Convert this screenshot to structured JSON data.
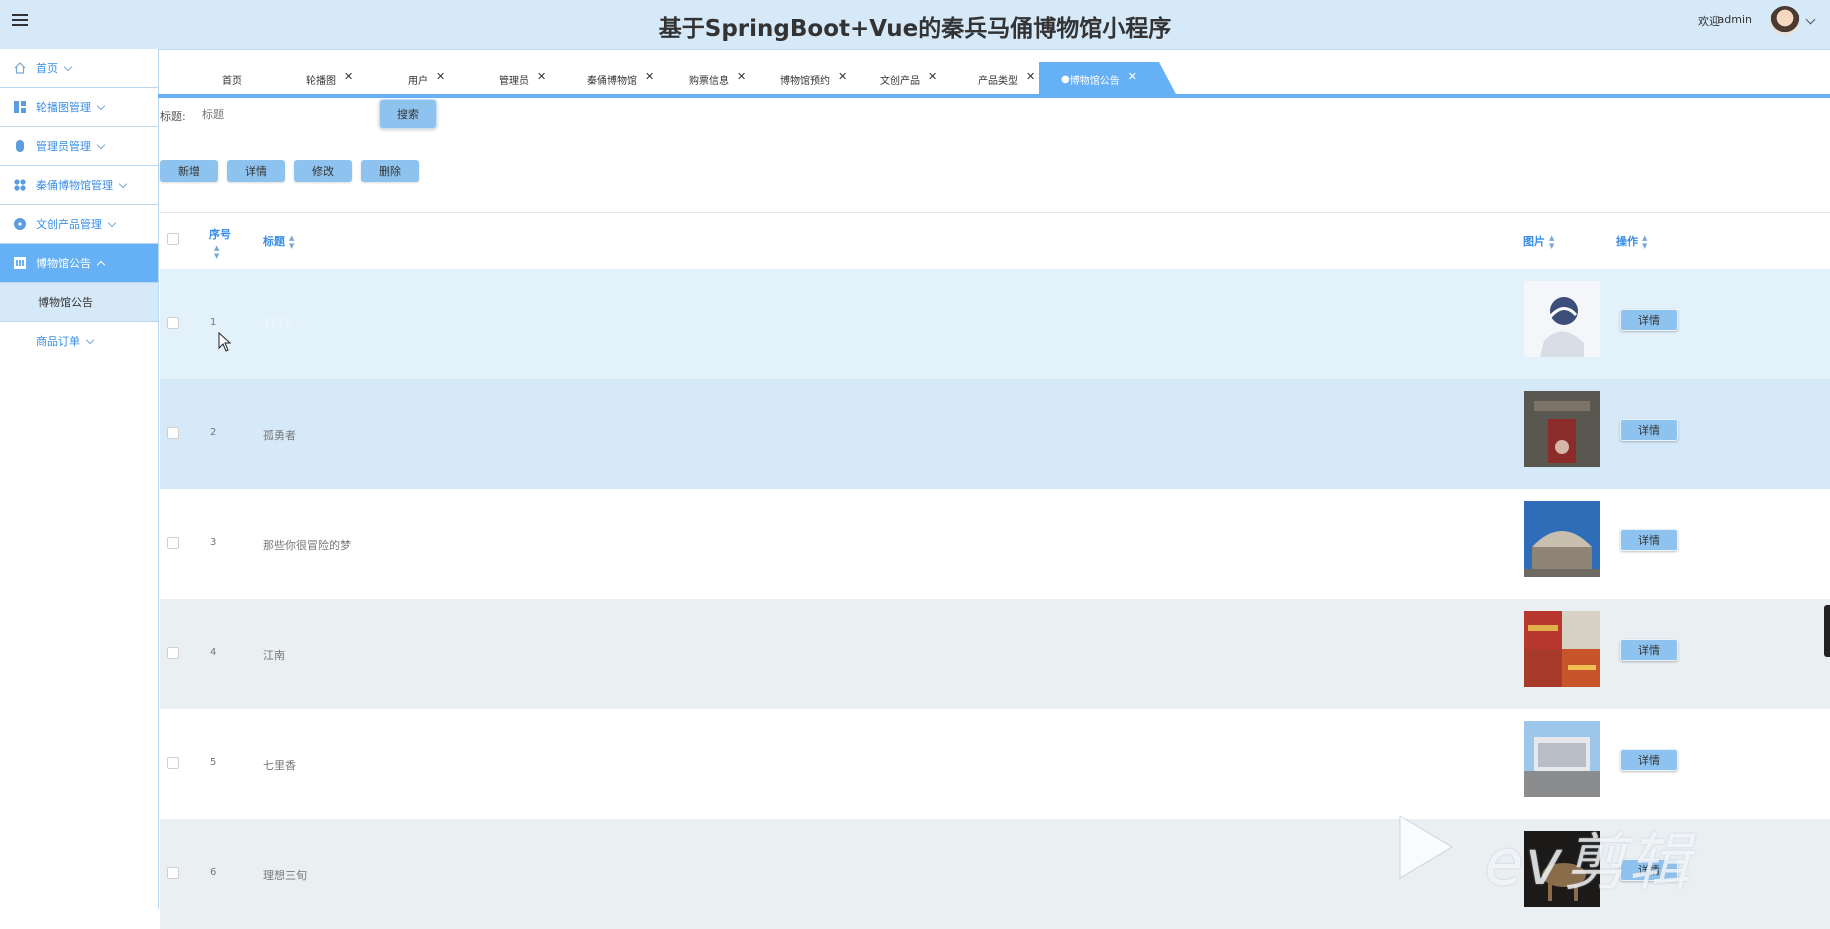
{
  "header": {
    "title": "基于SpringBoot+Vue的秦兵马俑博物馆小程序",
    "welcome": "欢迎",
    "username": "admin"
  },
  "sidebar": {
    "items": [
      {
        "label": "首页",
        "icon": "home-icon"
      },
      {
        "label": "轮播图管理",
        "icon": "dashboard-icon"
      },
      {
        "label": "管理员管理",
        "icon": "user-icon"
      },
      {
        "label": "秦俑博物馆管理",
        "icon": "grid-icon"
      },
      {
        "label": "文创产品管理",
        "icon": "circle-icon"
      },
      {
        "label": "博物馆公告",
        "icon": "notice-icon",
        "active": true
      }
    ],
    "submenu": [
      "博物馆公告"
    ],
    "extra": "商品订单"
  },
  "tabs": [
    {
      "label": "首页"
    },
    {
      "label": "轮播图"
    },
    {
      "label": "用户"
    },
    {
      "label": "管理员"
    },
    {
      "label": "秦俑博物馆"
    },
    {
      "label": "购票信息"
    },
    {
      "label": "博物馆预约"
    },
    {
      "label": "文创产品"
    },
    {
      "label": "产品类型"
    },
    {
      "label": "博物馆公告",
      "active": true
    }
  ],
  "search": {
    "label": "标题:",
    "placeholder": "标题",
    "button": "搜索"
  },
  "actions": {
    "add": "新增",
    "detail": "详情",
    "edit": "修改",
    "delete": "删除"
  },
  "table": {
    "headers": {
      "index": "序号",
      "title": "标题",
      "image": "图片",
      "action": "操作"
    },
    "rows": [
      {
        "index": "1",
        "title": "1111",
        "detail": "详情",
        "bg": "#e3f1fb"
      },
      {
        "index": "2",
        "title": "孤勇者",
        "detail": "详情",
        "bg": "#d6e9f8"
      },
      {
        "index": "3",
        "title": "那些你很冒险的梦",
        "detail": "详情",
        "bg": "#ffffff"
      },
      {
        "index": "4",
        "title": "江南",
        "detail": "详情",
        "bg": "#eaeff2"
      },
      {
        "index": "5",
        "title": "七里香",
        "detail": "详情",
        "bg": "#ffffff"
      },
      {
        "index": "6",
        "title": "理想三旬",
        "detail": "详情",
        "bg": "#eaeff2"
      }
    ]
  },
  "watermark": "ev剪辑",
  "colors": {
    "accent": "#66b1f5",
    "button": "#8fc3ef",
    "header_bg": "#d6e9f8"
  }
}
